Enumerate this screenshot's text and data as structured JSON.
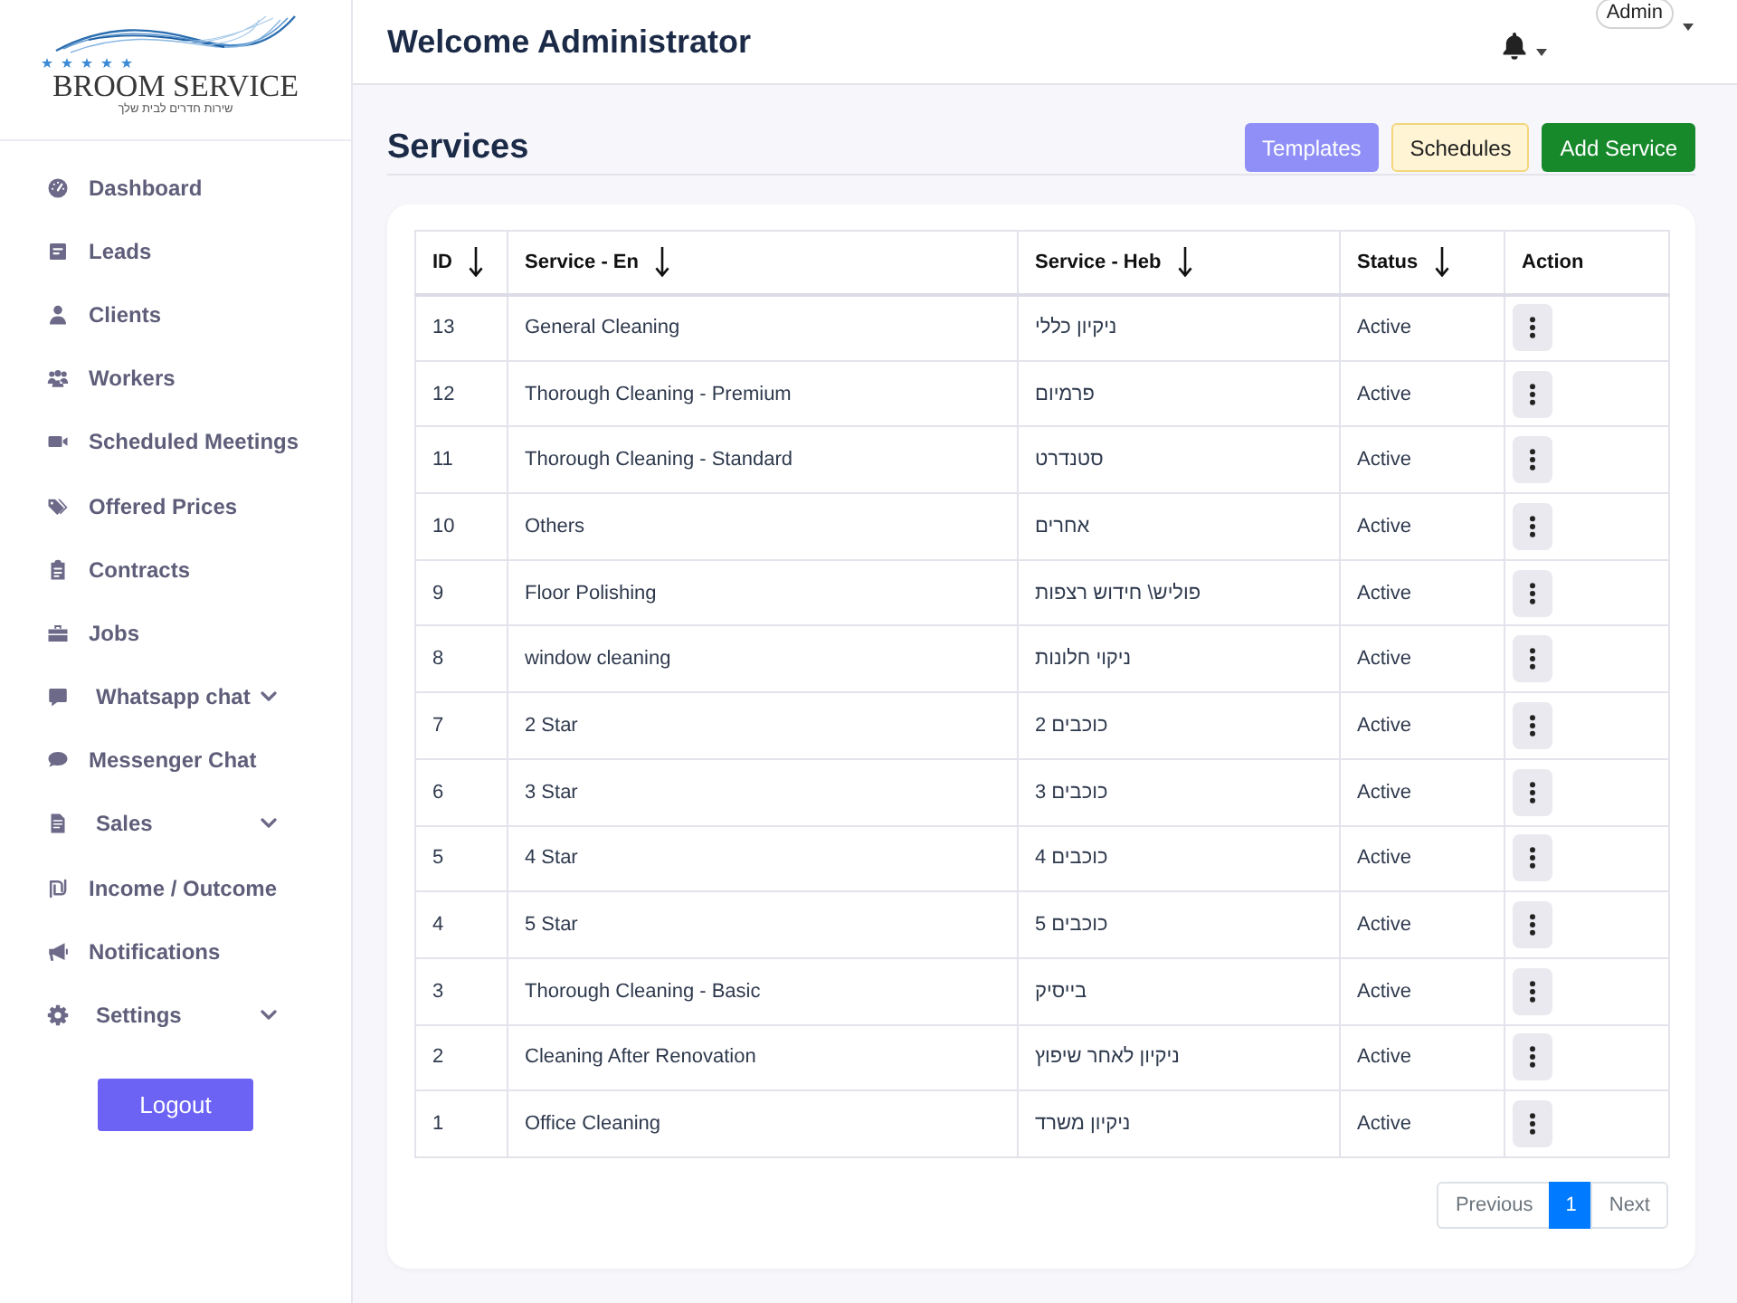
{
  "logo": {
    "name": "BROOM SERVICE",
    "tagline": "שירות חדרים לבית שלך"
  },
  "sidebar": {
    "items": [
      {
        "label": "Dashboard",
        "kind": "link",
        "selected": false
      },
      {
        "label": "Leads",
        "kind": "link",
        "selected": false
      },
      {
        "label": "Clients",
        "kind": "link",
        "selected": false
      },
      {
        "label": "Workers",
        "kind": "link",
        "selected": false
      },
      {
        "label": "Scheduled Meetings",
        "kind": "link",
        "selected": false
      },
      {
        "label": "Offered Prices",
        "kind": "link",
        "selected": false
      },
      {
        "label": "Contracts",
        "kind": "link",
        "selected": false
      },
      {
        "label": "Jobs",
        "kind": "link",
        "selected": false
      },
      {
        "label": "Whatsapp chat",
        "kind": "group",
        "selected": false
      },
      {
        "label": "Messenger Chat",
        "kind": "link",
        "selected": false
      },
      {
        "label": "Sales",
        "kind": "group",
        "selected": false
      },
      {
        "label": "Income / Outcome",
        "kind": "link",
        "selected": false
      },
      {
        "label": "Notifications",
        "kind": "link",
        "selected": false
      },
      {
        "label": "Settings",
        "kind": "group",
        "selected": false
      }
    ],
    "logout": "Logout"
  },
  "header": {
    "title": "Welcome Administrator",
    "user": "Admin"
  },
  "page": {
    "title": "Services",
    "buttons": [
      {
        "label": "Templates",
        "kind": "info"
      },
      {
        "label": "Schedules",
        "kind": "warning"
      },
      {
        "label": "Add Service",
        "kind": "success"
      }
    ]
  },
  "table": {
    "columns": [
      {
        "label": "ID",
        "sortable": true
      },
      {
        "label": "Service - En",
        "sortable": true
      },
      {
        "label": "Service - Heb",
        "sortable": true
      },
      {
        "label": "Status",
        "sortable": true
      },
      {
        "label": "Action",
        "sortable": false
      }
    ],
    "rows": [
      {
        "id": "13",
        "service_en": "General Cleaning",
        "service_heb": "ניקיון כללי",
        "status": "Active"
      },
      {
        "id": "12",
        "service_en": "Thorough Cleaning - Premium",
        "service_heb": "פרמיום",
        "status": "Active"
      },
      {
        "id": "11",
        "service_en": "Thorough Cleaning - Standard",
        "service_heb": "סטנדרט",
        "status": "Active"
      },
      {
        "id": "10",
        "service_en": "Others",
        "service_heb": "אחרים",
        "status": "Active"
      },
      {
        "id": "9",
        "service_en": "Floor Polishing",
        "service_heb": "פוליש\\ חידוש רצפות",
        "status": "Active"
      },
      {
        "id": "8",
        "service_en": "window cleaning",
        "service_heb": "ניקוי חלונות",
        "status": "Active"
      },
      {
        "id": "7",
        "service_en": "2 Star",
        "service_heb": "כוכבים 2",
        "status": "Active"
      },
      {
        "id": "6",
        "service_en": "3 Star",
        "service_heb": "כוכבים 3",
        "status": "Active"
      },
      {
        "id": "5",
        "service_en": "4 Star",
        "service_heb": "כוכבים 4",
        "status": "Active"
      },
      {
        "id": "4",
        "service_en": "5 Star",
        "service_heb": "כוכבים 5",
        "status": "Active"
      },
      {
        "id": "3",
        "service_en": "Thorough Cleaning - Basic",
        "service_heb": "בייסיק",
        "status": "Active"
      },
      {
        "id": "2",
        "service_en": "Cleaning After Renovation",
        "service_heb": "ניקיון לאחר שיפוץ",
        "status": "Active"
      },
      {
        "id": "1",
        "service_en": "Office Cleaning",
        "service_heb": "ניקיון משרד",
        "status": "Active"
      }
    ]
  },
  "pagination": {
    "previous": {
      "label": "Previous",
      "disabled": true
    },
    "pages": [
      {
        "label": "1",
        "selected": true
      }
    ],
    "next": {
      "label": "Next",
      "disabled": true
    }
  }
}
